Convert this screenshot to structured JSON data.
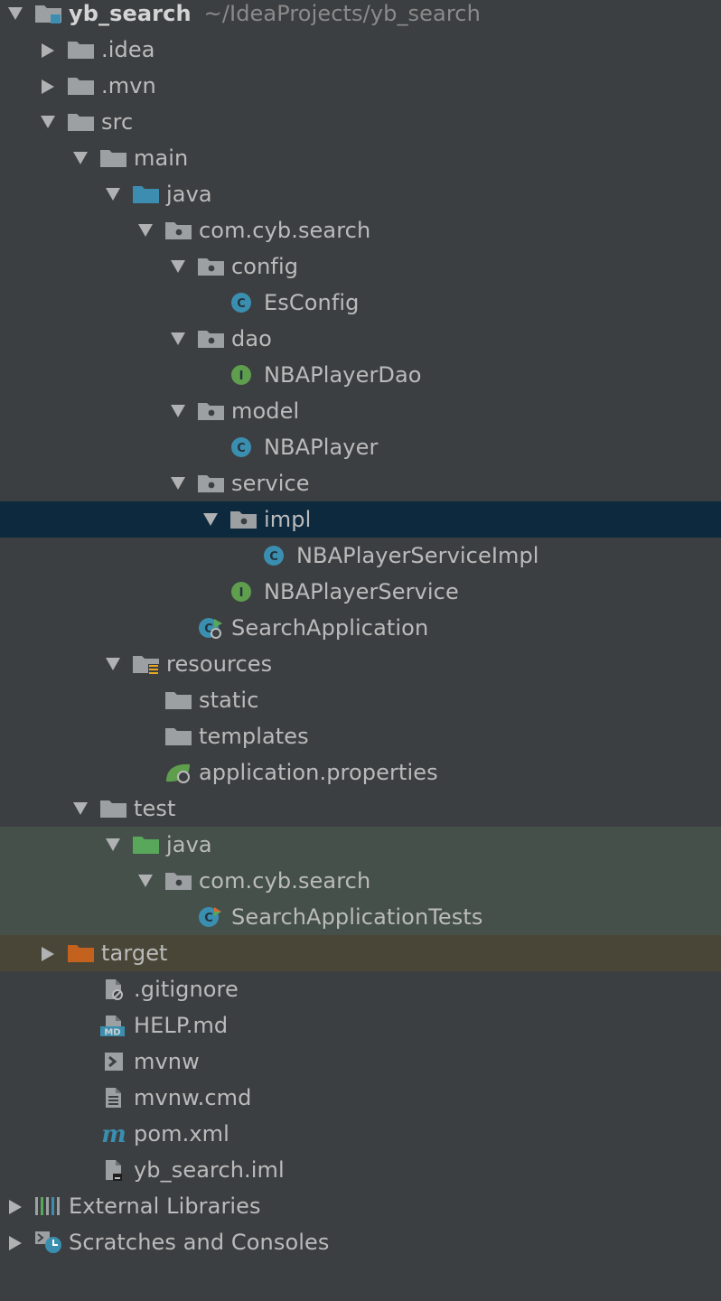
{
  "colors": {
    "background": "#3C3F41",
    "text": "#BBBBBB",
    "selected_row": "#0D293E",
    "test_row": "#45504A",
    "excluded_row": "#4A4637",
    "folder": "#9DA0A2",
    "source_folder": "#3D8DB0",
    "test_folder": "#59A75B",
    "excluded_folder": "#C3621F",
    "class_icon": "#3A8FB0",
    "interface_icon": "#5E9E4D"
  },
  "tree": [
    {
      "label": "yb_search",
      "hint": "~/IdeaProjects/yb_search",
      "depth": 0,
      "arrow": "down",
      "icon": "module-folder-icon",
      "bold": true
    },
    {
      "label": ".idea",
      "depth": 1,
      "arrow": "right",
      "icon": "folder-icon"
    },
    {
      "label": ".mvn",
      "depth": 1,
      "arrow": "right",
      "icon": "folder-icon"
    },
    {
      "label": "src",
      "depth": 1,
      "arrow": "down",
      "icon": "folder-icon"
    },
    {
      "label": "main",
      "depth": 2,
      "arrow": "down",
      "icon": "folder-icon"
    },
    {
      "label": "java",
      "depth": 3,
      "arrow": "down",
      "icon": "source-folder-icon"
    },
    {
      "label": "com.cyb.search",
      "depth": 4,
      "arrow": "down",
      "icon": "package-icon"
    },
    {
      "label": "config",
      "depth": 5,
      "arrow": "down",
      "icon": "package-icon"
    },
    {
      "label": "EsConfig",
      "depth": 6,
      "arrow": "none",
      "icon": "class-icon"
    },
    {
      "label": "dao",
      "depth": 5,
      "arrow": "down",
      "icon": "package-icon"
    },
    {
      "label": "NBAPlayerDao",
      "depth": 6,
      "arrow": "none",
      "icon": "interface-icon"
    },
    {
      "label": "model",
      "depth": 5,
      "arrow": "down",
      "icon": "package-icon"
    },
    {
      "label": "NBAPlayer",
      "depth": 6,
      "arrow": "none",
      "icon": "class-icon"
    },
    {
      "label": "service",
      "depth": 5,
      "arrow": "down",
      "icon": "package-icon"
    },
    {
      "label": "impl",
      "depth": 6,
      "arrow": "down",
      "icon": "package-icon",
      "state": "selected"
    },
    {
      "label": "NBAPlayerServiceImpl",
      "depth": 7,
      "arrow": "none",
      "icon": "class-icon"
    },
    {
      "label": "NBAPlayerService",
      "depth": 6,
      "arrow": "none",
      "icon": "interface-icon"
    },
    {
      "label": "SearchApplication",
      "depth": 5,
      "arrow": "none",
      "icon": "spring-boot-class-icon"
    },
    {
      "label": "resources",
      "depth": 3,
      "arrow": "down",
      "icon": "resources-folder-icon"
    },
    {
      "label": "static",
      "depth": 4,
      "arrow": "none",
      "icon": "folder-icon"
    },
    {
      "label": "templates",
      "depth": 4,
      "arrow": "none",
      "icon": "folder-icon"
    },
    {
      "label": "application.properties",
      "depth": 4,
      "arrow": "none",
      "icon": "spring-properties-icon"
    },
    {
      "label": "test",
      "depth": 2,
      "arrow": "down",
      "icon": "folder-icon"
    },
    {
      "label": "java",
      "depth": 3,
      "arrow": "down",
      "icon": "test-folder-icon",
      "state": "test"
    },
    {
      "label": "com.cyb.search",
      "depth": 4,
      "arrow": "down",
      "icon": "package-icon",
      "state": "test"
    },
    {
      "label": "SearchApplicationTests",
      "depth": 5,
      "arrow": "none",
      "icon": "test-class-icon",
      "state": "test"
    },
    {
      "label": "target",
      "depth": 1,
      "arrow": "right",
      "icon": "excluded-folder-icon",
      "state": "excluded"
    },
    {
      "label": ".gitignore",
      "depth": 2,
      "arrow": "none",
      "icon": "ignored-file-icon"
    },
    {
      "label": "HELP.md",
      "depth": 2,
      "arrow": "none",
      "icon": "markdown-file-icon"
    },
    {
      "label": "mvnw",
      "depth": 2,
      "arrow": "none",
      "icon": "shell-script-icon"
    },
    {
      "label": "mvnw.cmd",
      "depth": 2,
      "arrow": "none",
      "icon": "text-file-icon"
    },
    {
      "label": "pom.xml",
      "depth": 2,
      "arrow": "none",
      "icon": "maven-icon"
    },
    {
      "label": "yb_search.iml",
      "depth": 2,
      "arrow": "none",
      "icon": "iml-file-icon"
    },
    {
      "label": "External Libraries",
      "depth": 0,
      "arrow": "right",
      "icon": "libraries-icon"
    },
    {
      "label": "Scratches and Consoles",
      "depth": 0,
      "arrow": "right",
      "icon": "scratches-icon"
    }
  ]
}
